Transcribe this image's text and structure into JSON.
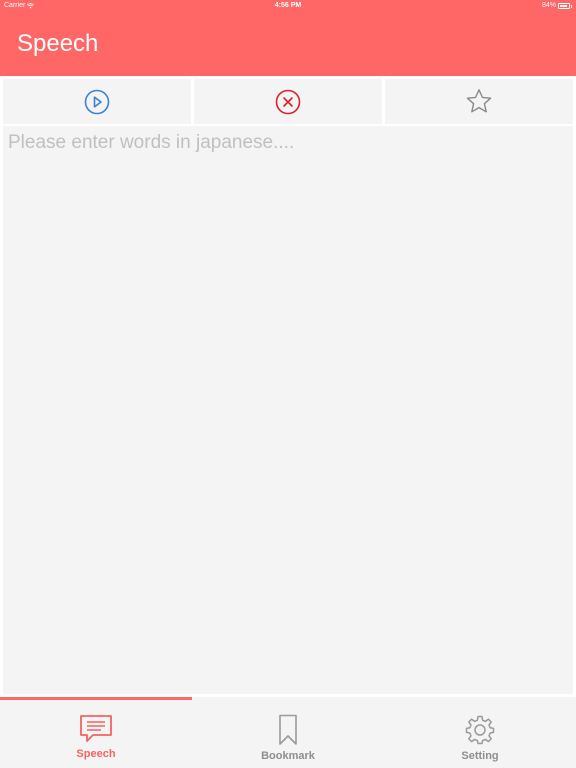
{
  "status": {
    "carrier": "Carrier",
    "time": "4:56 PM",
    "battery": "84%"
  },
  "header": {
    "title": "Speech",
    "background": "#FF6666"
  },
  "toolbar": {
    "play_icon": "play-circle-icon",
    "clear_icon": "close-circle-icon",
    "bookmark_icon": "star-outline-icon",
    "play_color": "#3B82D6",
    "clear_color": "#D9222A"
  },
  "editor": {
    "placeholder": "Please enter words in japanese....",
    "value": ""
  },
  "tabs": [
    {
      "label": "Speech",
      "icon": "chat-bubble-icon",
      "active": true
    },
    {
      "label": "Bookmark",
      "icon": "bookmark-icon",
      "active": false
    },
    {
      "label": "Setting",
      "icon": "gear-icon",
      "active": false
    }
  ],
  "colors": {
    "accent": "#FF6666",
    "tab_active": "#F26462",
    "tab_inactive": "#8E8E8E"
  }
}
